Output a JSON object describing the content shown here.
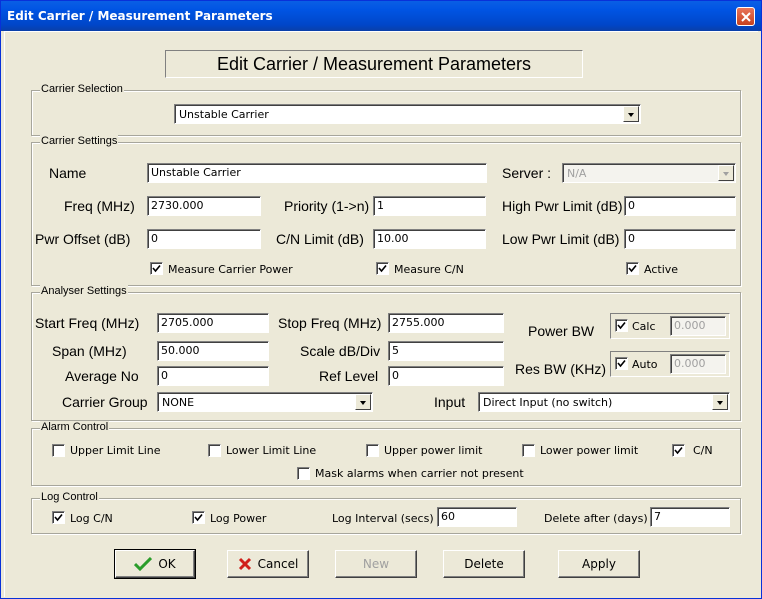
{
  "window": {
    "title": "Edit Carrier / Measurement Parameters"
  },
  "header": {
    "title": "Edit Carrier / Measurement Parameters"
  },
  "carrier_selection": {
    "title": "Carrier Selection",
    "selected": "Unstable Carrier"
  },
  "carrier_settings": {
    "title": "Carrier Settings",
    "name_label": "Name",
    "name_value": "Unstable Carrier",
    "server_label": "Server :",
    "server_value": "N/A",
    "freq_label": "Freq (MHz)",
    "freq_value": "2730.000",
    "priority_label": "Priority (1->n)",
    "priority_value": "1",
    "high_pwr_label": "High Pwr Limit (dB)",
    "high_pwr_value": "0",
    "pwr_offset_label": "Pwr Offset (dB)",
    "pwr_offset_value": "0",
    "cn_limit_label": "C/N Limit (dB)",
    "cn_limit_value": "10.00",
    "low_pwr_label": "Low Pwr Limit (dB)",
    "low_pwr_value": "0",
    "measure_power_label": "Measure Carrier Power",
    "measure_power_checked": true,
    "measure_cn_label": "Measure C/N",
    "measure_cn_checked": true,
    "active_label": "Active",
    "active_checked": true
  },
  "analyser_settings": {
    "title": "Analyser Settings",
    "start_freq_label": "Start Freq (MHz)",
    "start_freq_value": "2705.000",
    "stop_freq_label": "Stop Freq (MHz)",
    "stop_freq_value": "2755.000",
    "power_bw_label": "Power BW",
    "calc_label": "Calc",
    "calc_checked": true,
    "power_bw_value": "0.000",
    "span_label": "Span (MHz)",
    "span_value": "50.000",
    "scale_label": "Scale dB/Div",
    "scale_value": "5",
    "res_bw_label": "Res BW (KHz)",
    "auto_label": "Auto",
    "auto_checked": true,
    "res_bw_value": "0.000",
    "average_label": "Average No",
    "average_value": "0",
    "ref_level_label": "Ref Level",
    "ref_level_value": "0",
    "carrier_group_label": "Carrier Group",
    "carrier_group_value": "NONE",
    "input_label": "Input",
    "input_value": "Direct Input (no switch)"
  },
  "alarm_control": {
    "title": "Alarm Control",
    "upper_limit_line": "Upper Limit Line",
    "lower_limit_line": "Lower Limit Line",
    "upper_power_limit": "Upper power limit",
    "lower_power_limit": "Lower power limit",
    "cn": "C/N",
    "mask_alarms": "Mask alarms when carrier not present"
  },
  "log_control": {
    "title": "Log Control",
    "log_cn_label": "Log C/N",
    "log_power_label": "Log Power",
    "interval_label": "Log Interval (secs)",
    "interval_value": "60",
    "delete_label": "Delete after (days)",
    "delete_value": "7"
  },
  "buttons": {
    "ok": "OK",
    "cancel": "Cancel",
    "new": "New",
    "delete": "Delete",
    "apply": "Apply"
  },
  "colors": {
    "titlebar": "#0054e3",
    "face": "#ece9d8",
    "ok_icon": "#2a9d2a",
    "cancel_icon": "#d0201a"
  }
}
